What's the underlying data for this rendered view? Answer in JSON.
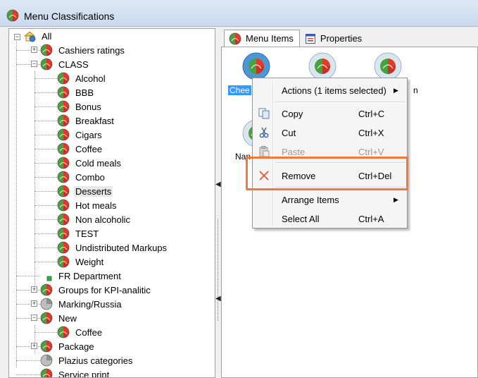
{
  "window": {
    "title": "Menu Classifications"
  },
  "tree": {
    "root": "All",
    "items": [
      {
        "label": "Cashiers ratings"
      },
      {
        "label": "CLASS"
      },
      {
        "label": "Alcohol"
      },
      {
        "label": "BBB"
      },
      {
        "label": "Bonus"
      },
      {
        "label": "Breakfast"
      },
      {
        "label": "Cigars"
      },
      {
        "label": "Coffee"
      },
      {
        "label": "Cold meals"
      },
      {
        "label": "Combo"
      },
      {
        "label": "Desserts"
      },
      {
        "label": "Hot meals"
      },
      {
        "label": "Non alcoholic"
      },
      {
        "label": "TEST"
      },
      {
        "label": "Undistributed Markups"
      },
      {
        "label": "Weight"
      },
      {
        "label": "FR Department"
      },
      {
        "label": "Groups for KPI-analitic"
      },
      {
        "label": "Marking/Russia"
      },
      {
        "label": "New"
      },
      {
        "label": "Coffee"
      },
      {
        "label": "Package"
      },
      {
        "label": "Plazius categories"
      },
      {
        "label": "Service print"
      }
    ]
  },
  "tabs": [
    {
      "label": "Menu Items"
    },
    {
      "label": "Properties"
    }
  ],
  "menu_items": [
    {
      "label": "Chee"
    },
    {
      "label": "Nan"
    },
    {
      "label": "n"
    }
  ],
  "context_menu": {
    "items": [
      {
        "label": "Actions (1 items selected)",
        "submenu": "▶"
      },
      {
        "label": "Copy",
        "shortcut": "Ctrl+C"
      },
      {
        "label": "Cut",
        "shortcut": "Ctrl+X"
      },
      {
        "label": "Paste",
        "shortcut": "Ctrl+V"
      },
      {
        "label": "Remove",
        "shortcut": "Ctrl+Del"
      },
      {
        "label": "Arrange Items",
        "submenu": "▶"
      },
      {
        "label": "Select All",
        "shortcut": "Ctrl+A"
      }
    ]
  },
  "colors": {
    "selection": "#3399ff",
    "highlight_outline": "#f07a3a",
    "remove_icon": "#e8543a"
  }
}
